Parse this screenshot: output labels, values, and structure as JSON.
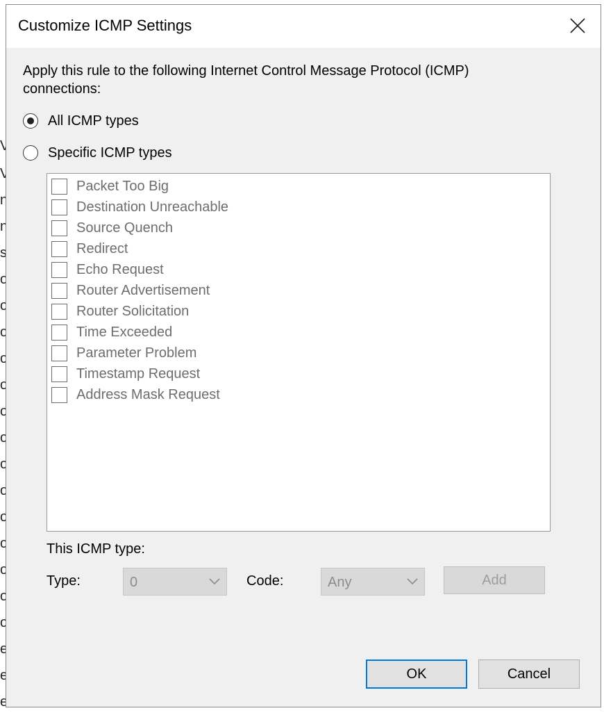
{
  "dialog": {
    "title": "Customize ICMP Settings",
    "intro": "Apply this rule to the following Internet Control Message Protocol (ICMP) connections:"
  },
  "options": {
    "all": {
      "label": "All ICMP types",
      "checked": true
    },
    "specific": {
      "label": "Specific ICMP types",
      "checked": false
    }
  },
  "icmp_types": [
    {
      "label": "Packet Too Big",
      "checked": false
    },
    {
      "label": "Destination Unreachable",
      "checked": false
    },
    {
      "label": "Source Quench",
      "checked": false
    },
    {
      "label": "Redirect",
      "checked": false
    },
    {
      "label": "Echo Request",
      "checked": false
    },
    {
      "label": "Router Advertisement",
      "checked": false
    },
    {
      "label": "Router Solicitation",
      "checked": false
    },
    {
      "label": "Time Exceeded",
      "checked": false
    },
    {
      "label": "Parameter Problem",
      "checked": false
    },
    {
      "label": "Timestamp Request",
      "checked": false
    },
    {
      "label": "Address Mask Request",
      "checked": false
    }
  ],
  "this_type": {
    "heading": "This ICMP type:",
    "type_label": "Type:",
    "type_value": "0",
    "code_label": "Code:",
    "code_value": "Any",
    "add_label": "Add"
  },
  "buttons": {
    "ok": "OK",
    "cancel": "Cancel"
  },
  "colors": {
    "accent": "#0078d7",
    "dialog_bg": "#f0f0f0",
    "disabled_text": "#6d6d6d"
  },
  "background_window": {
    "glyphs": [
      "V",
      "V",
      "n",
      "n",
      "s",
      "o",
      "o",
      "o",
      "o",
      "o",
      "o",
      "o",
      "o",
      "o",
      "o",
      "o",
      "o",
      "o",
      "o",
      "e",
      "e",
      "e"
    ]
  }
}
